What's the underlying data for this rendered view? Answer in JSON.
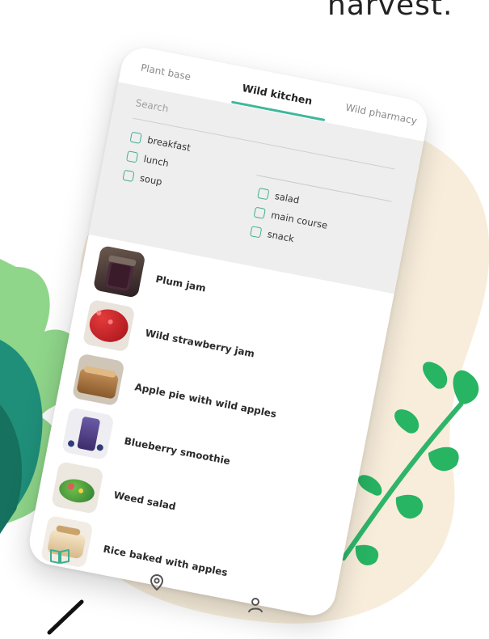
{
  "header_text": "harvest.",
  "tabs": [
    {
      "label": "Plant base",
      "active": false
    },
    {
      "label": "Wild kitchen",
      "active": true
    },
    {
      "label": "Wild pharmacy",
      "active": false
    }
  ],
  "search": {
    "placeholder": "Search"
  },
  "filters_left": [
    {
      "label": "breakfast",
      "checked": false
    },
    {
      "label": "lunch",
      "checked": false
    },
    {
      "label": "soup",
      "checked": false
    }
  ],
  "filters_right": [
    {
      "label": "salad",
      "checked": false
    },
    {
      "label": "main course",
      "checked": false
    },
    {
      "label": "snack",
      "checked": false
    }
  ],
  "recipes": [
    {
      "title": "Plum jam"
    },
    {
      "title": "Wild strawberry jam"
    },
    {
      "title": "Apple pie with wild apples"
    },
    {
      "title": "Blueberry smoothie"
    },
    {
      "title": "Weed salad"
    },
    {
      "title": "Rice baked with apples"
    }
  ],
  "bottom_nav": [
    {
      "icon": "book-icon",
      "active": true
    },
    {
      "icon": "location-pin-icon",
      "active": false
    },
    {
      "icon": "user-icon",
      "active": false
    }
  ],
  "colors": {
    "accent": "#3fb89a",
    "blob": "#f8eddb",
    "leaf_light": "#8fd68a",
    "leaf_dark": "#1f8f7a"
  }
}
